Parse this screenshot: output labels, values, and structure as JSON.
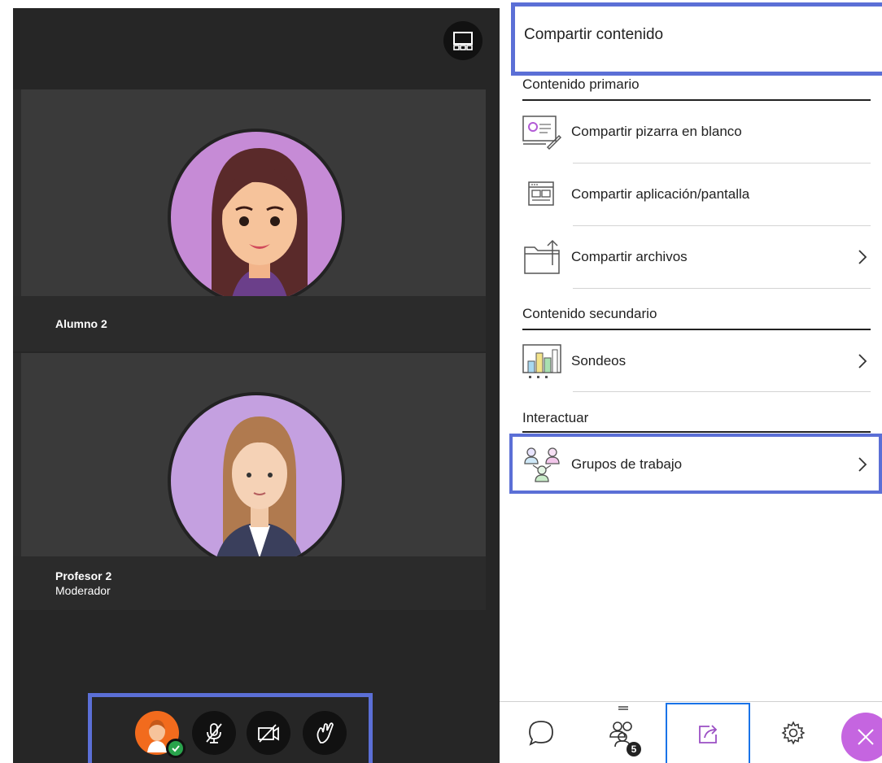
{
  "video": {
    "tiles": [
      {
        "name": "Alumno 2",
        "role": ""
      },
      {
        "name": "Profesor 2",
        "role": "Moderador"
      }
    ],
    "controls": {
      "avatar_icon": "user-avatar-icon",
      "mic_icon": "mic-off-icon",
      "cam_icon": "camera-off-icon",
      "hand_icon": "raise-hand-icon"
    }
  },
  "panel": {
    "title": "Compartir contenido",
    "sections": [
      {
        "heading": "Contenido primario",
        "items": [
          {
            "label": "Compartir pizarra en blanco",
            "icon": "whiteboard-icon"
          },
          {
            "label": "Compartir aplicación/pantalla",
            "icon": "app-screen-icon"
          },
          {
            "label": "Compartir archivos",
            "icon": "folder-share-icon"
          }
        ]
      },
      {
        "heading": "Contenido secundario",
        "items": [
          {
            "label": "Sondeos",
            "icon": "poll-chart-icon"
          }
        ]
      },
      {
        "heading": "Interactuar",
        "items": [
          {
            "label": "Grupos de trabajo",
            "icon": "breakout-groups-icon"
          }
        ]
      }
    ]
  },
  "bottom_bar": {
    "attendees_count": "5"
  },
  "colors": {
    "highlight": "#5b6fd6",
    "close": "#c565e0",
    "share_tab": "#1a73e8",
    "accent_purple": "#9b4fc4"
  }
}
